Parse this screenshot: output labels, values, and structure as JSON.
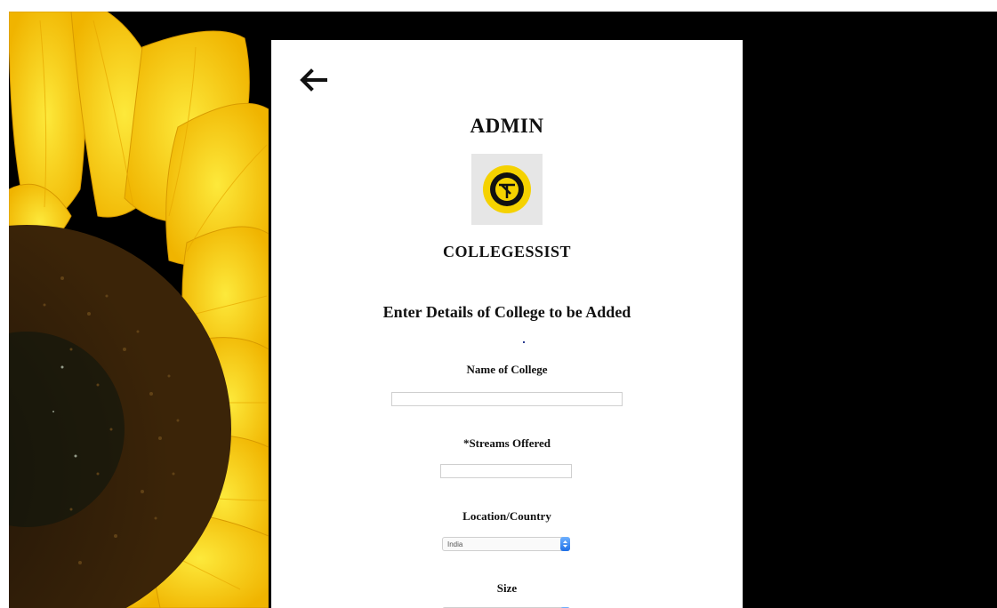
{
  "admin_panel": {
    "title": "ADMIN",
    "logo_icon": "collegessist-logo-icon",
    "brand_name": "COLLEGESSIST",
    "back_icon": "back-arrow-icon"
  },
  "form": {
    "heading": "Enter Details of College to be Added",
    "college_name": {
      "label": "Name of College",
      "value": ""
    },
    "streams": {
      "label": "*Streams Offered",
      "value": ""
    },
    "location": {
      "label": "Location/Country",
      "selected": "India"
    },
    "size": {
      "label": "Size"
    }
  },
  "colors": {
    "page_background": "#000000",
    "card_background": "#ffffff",
    "logo_yellow": "#f5d200",
    "select_button_blue": "#1f6fe6"
  }
}
